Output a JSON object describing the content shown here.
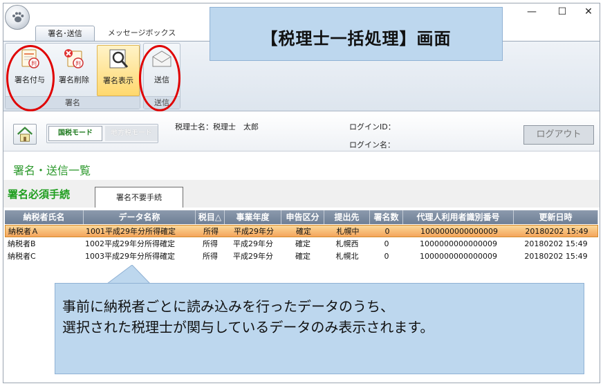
{
  "tabs": {
    "sign_send": "署名･送信",
    "message_box": "メッセージボックス"
  },
  "window_controls": {
    "minimize": "—",
    "maximize": "☐",
    "close": "✕"
  },
  "ribbon": {
    "sign_group": {
      "label": "署名",
      "buttons": [
        {
          "label": "署名付与",
          "icon": "certificate-add-icon"
        },
        {
          "label": "署名削除",
          "icon": "certificate-delete-icon"
        },
        {
          "label": "署名表示",
          "icon": "magnifier-icon"
        }
      ]
    },
    "send_group": {
      "label": "送信",
      "button": "送信",
      "icon": "envelope-icon"
    }
  },
  "callout_title": "【税理士一括処理】画面",
  "info": {
    "mode_national": "国税モード",
    "mode_local": "地方税モード",
    "accountant": "税理士名：税理士　太郎",
    "login_id": "ログインID：",
    "login_name": "ログイン名：",
    "logout": "ログアウト"
  },
  "list_title": "署名・送信一覧",
  "section_tabs": {
    "required": "署名必須手続",
    "not_required": "署名不要手続"
  },
  "table": {
    "columns": [
      "納税者氏名",
      "データ名称",
      "税目△",
      "事業年度",
      "申告区分",
      "提出先",
      "署名数",
      "代理人利用者識別番号",
      "更新日時"
    ],
    "rows": [
      [
        "納税者Ａ",
        "1001平成29年分所得確定",
        "所得",
        "平成29年分",
        "確定",
        "札幌中",
        "0",
        "1000000000000009",
        "20180202 15:49"
      ],
      [
        "納税者B",
        "1002平成29年分所得確定",
        "所得",
        "平成29年分",
        "確定",
        "札幌西",
        "0",
        "1000000000000009",
        "20180202 15:49"
      ],
      [
        "納税者C",
        "1003平成29年分所得確定",
        "所得",
        "平成29年分",
        "確定",
        "札幌北",
        "0",
        "1000000000000009",
        "20180202 15:49"
      ]
    ],
    "selected_row": 0
  },
  "callout_bottom": {
    "line1": "事前に納税者ごとに読み込みを行ったデータのうち、",
    "line2": "選択された税理士が関与しているデータのみ表示されます。"
  },
  "colors": {
    "accent_green": "#2e9a2e",
    "highlight_red": "#e00000",
    "callout_blue": "#bdd7ee"
  }
}
